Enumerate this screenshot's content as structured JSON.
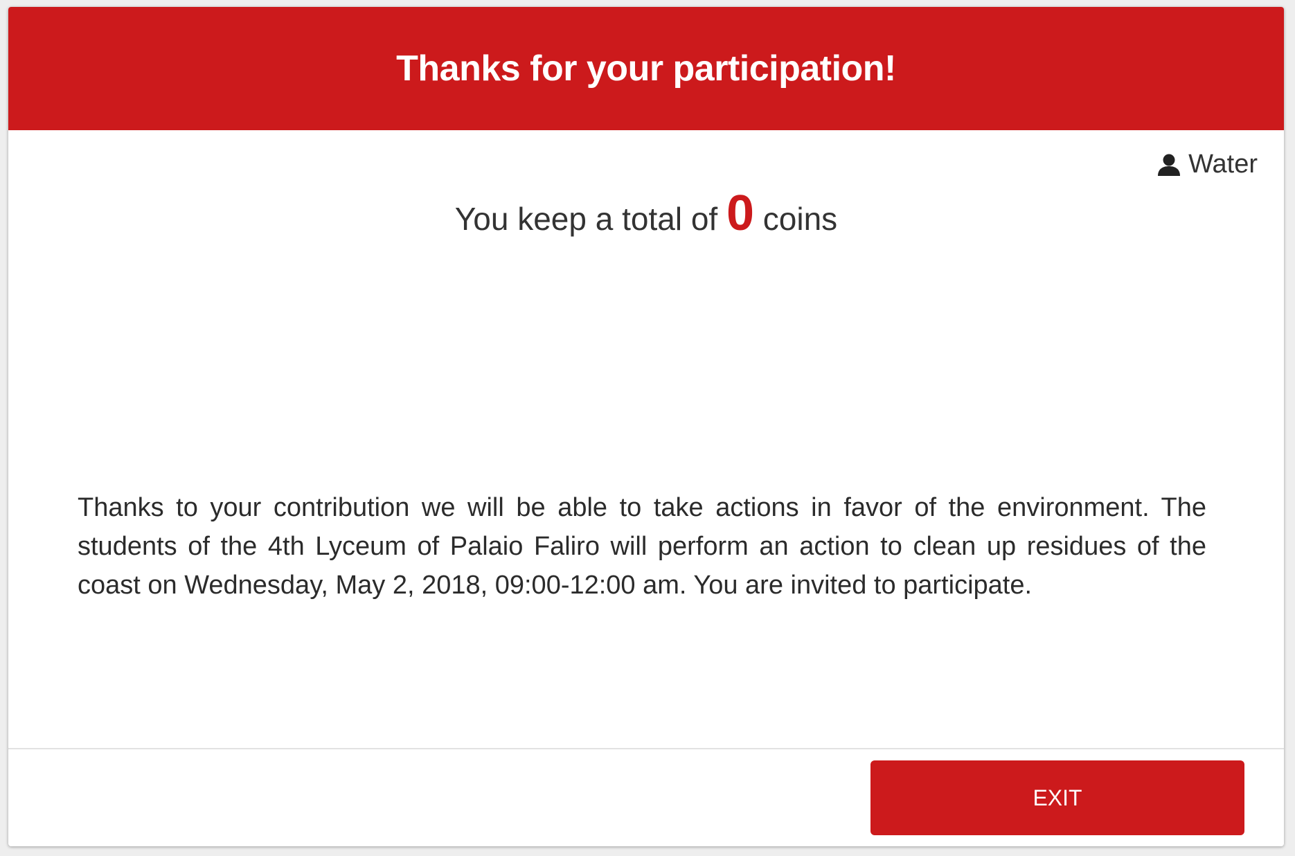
{
  "header": {
    "title": "Thanks for your participation!"
  },
  "user": {
    "icon": "user-icon",
    "name": "Water"
  },
  "summary": {
    "prefix": "You keep a total of ",
    "coins": "0",
    "suffix": " coins"
  },
  "message": "Thanks to your contribution we will be able to take actions in favor of the environment. The students of the 4th Lyceum of Palaio Faliro will perform an action to clean up residues of the coast on Wednesday, May 2, 2018, 09:00-12:00 am. You are invited to participate.",
  "footer": {
    "exit_label": "EXIT"
  },
  "colors": {
    "accent": "#cc1a1c",
    "text": "#333333",
    "background": "#ffffff"
  }
}
